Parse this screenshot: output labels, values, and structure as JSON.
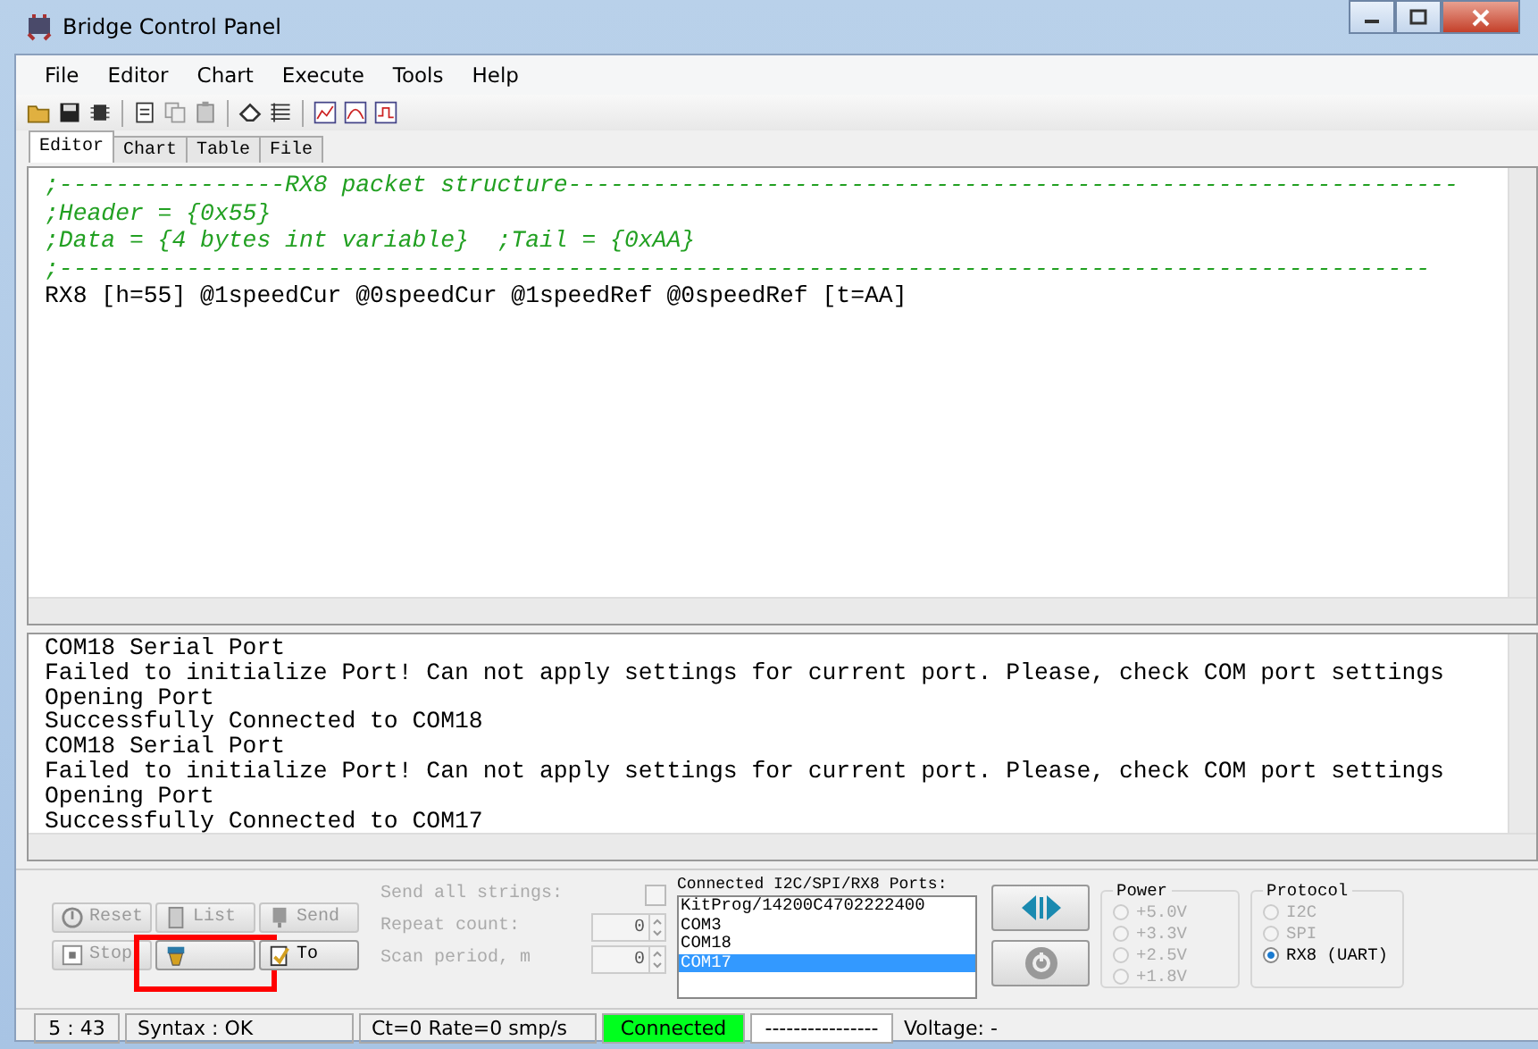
{
  "window": {
    "title": "Bridge Control Panel"
  },
  "menu": [
    "File",
    "Editor",
    "Chart",
    "Execute",
    "Tools",
    "Help"
  ],
  "tabs": [
    {
      "label": "Editor",
      "selected": true
    },
    {
      "label": "Chart",
      "selected": false
    },
    {
      "label": "Table",
      "selected": false
    },
    {
      "label": "File",
      "selected": false
    }
  ],
  "editor": {
    "lines": [
      {
        "kind": "comment",
        "text": ";----------------RX8 packet structure---------------------------------------------------------------"
      },
      {
        "kind": "comment",
        "text": ";Header = {0x55}"
      },
      {
        "kind": "comment",
        "text": ";Data = {4 bytes int variable}  ;Tail = {0xAA}"
      },
      {
        "kind": "comment",
        "text": ";-------------------------------------------------------------------------------------------------"
      },
      {
        "kind": "code",
        "text": "RX8 [h=55] @1speedCur @0speedCur @1speedRef @0speedRef [t=AA]"
      }
    ]
  },
  "log": {
    "lines": [
      "COM18 Serial Port",
      "Failed to initialize Port! Can not apply settings for current port. Please, check COM port settings",
      "Opening Port",
      "Successfully Connected to COM18",
      "COM18 Serial Port",
      "Failed to initialize Port! Can not apply settings for current port. Please, check COM port settings",
      "Opening Port",
      "Successfully Connected to COM17"
    ]
  },
  "buttons": [
    {
      "kind": "reset",
      "label": "Reset",
      "disabled": true
    },
    {
      "kind": "list",
      "label": "List",
      "disabled": true
    },
    {
      "kind": "send",
      "label": "Send",
      "disabled": true
    },
    {
      "kind": "stop",
      "label": "Stop",
      "disabled": true
    },
    {
      "kind": "run",
      "disabled": false
    },
    {
      "kind": "to",
      "label": "To",
      "disabled": false
    }
  ],
  "send_options": {
    "send_all": {
      "label": "Send all strings:",
      "checked": false,
      "disabled": true
    },
    "fields": [
      {
        "label": "Repeat count:",
        "value": "0",
        "disabled": true
      },
      {
        "label": "Scan period, m",
        "value": "0",
        "disabled": true
      }
    ]
  },
  "ports": {
    "label": "Connected I2C/SPI/RX8 Ports:",
    "items": [
      {
        "name": "KitProg/14200C4702222400",
        "selected": false
      },
      {
        "name": "COM3",
        "selected": false
      },
      {
        "name": "COM18",
        "selected": false
      },
      {
        "name": "COM17",
        "selected": true
      }
    ]
  },
  "power": {
    "label": "Power",
    "options": [
      {
        "label": "+5.0V",
        "selected": false,
        "disabled": true
      },
      {
        "label": "+3.3V",
        "selected": false,
        "disabled": true
      },
      {
        "label": "+2.5V",
        "selected": false,
        "disabled": true
      },
      {
        "label": "+1.8V",
        "selected": false,
        "disabled": true
      }
    ]
  },
  "protocol": {
    "label": "Protocol",
    "options": [
      {
        "label": "I2C",
        "selected": false,
        "disabled": true
      },
      {
        "label": "SPI",
        "selected": false,
        "disabled": true
      },
      {
        "label": "RX8 (UART)",
        "selected": true,
        "disabled": false
      }
    ]
  },
  "status_bar": {
    "cursor": "5 : 43",
    "syntax": "Syntax : OK",
    "rate": "Ct=0 Rate=0 smp/s",
    "connection": {
      "label": "Connected",
      "connected": true
    },
    "field": "----------------",
    "voltage": "Voltage: -"
  }
}
